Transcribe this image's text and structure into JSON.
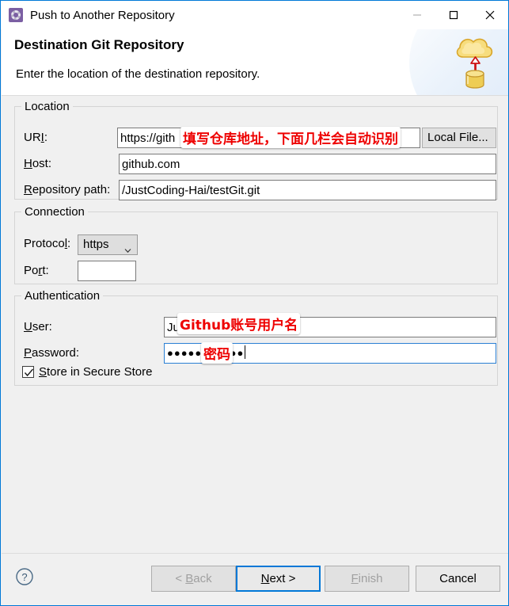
{
  "window": {
    "title": "Push to Another Repository",
    "app_icon": "gear-icon",
    "minimize_label": "—",
    "maximize_label": "□",
    "close_label": "✕"
  },
  "banner": {
    "title": "Destination Git Repository",
    "subtitle": "Enter the location of the destination repository.",
    "icon": "cloud-upload-database-icon",
    "accent_color": "#0078d7"
  },
  "location": {
    "group_title": "Location",
    "uri_label": "URI:",
    "uri_label_mnemonic": "I",
    "uri_value": "https://gith",
    "local_file_button": "Local File...",
    "host_label": "Host:",
    "host_label_mnemonic": "H",
    "host_value": "github.com",
    "repo_path_label": "Repository path:",
    "repo_path_label_mnemonic": "R",
    "repo_path_value": "/JustCoding-Hai/testGit.git"
  },
  "connection": {
    "group_title": "Connection",
    "protocol_label": "Protocol:",
    "protocol_label_mnemonic": "l",
    "protocol_value": "https",
    "port_label": "Port:",
    "port_label_mnemonic": "r",
    "port_value": ""
  },
  "authentication": {
    "group_title": "Authentication",
    "user_label": "User:",
    "user_label_mnemonic": "U",
    "user_value": "JustCoding-Hai",
    "password_label": "Password:",
    "password_label_mnemonic": "P",
    "password_masked": "●●●●●●●●●●●",
    "store_checkbox_label": "Store in Secure Store",
    "store_checkbox_mnemonic": "S",
    "store_checked": true
  },
  "annotations": {
    "color": "#ee0000",
    "uri_note": "填写仓库地址，下面几栏会自动识别",
    "user_note": "Github账号用户名",
    "password_note": "密码"
  },
  "footer": {
    "help_icon": "question-mark-icon",
    "back_label": "< Back",
    "back_mnemonic": "B",
    "next_label": "Next >",
    "next_mnemonic": "N",
    "finish_label": "Finish",
    "finish_mnemonic": "F",
    "cancel_label": "Cancel"
  }
}
